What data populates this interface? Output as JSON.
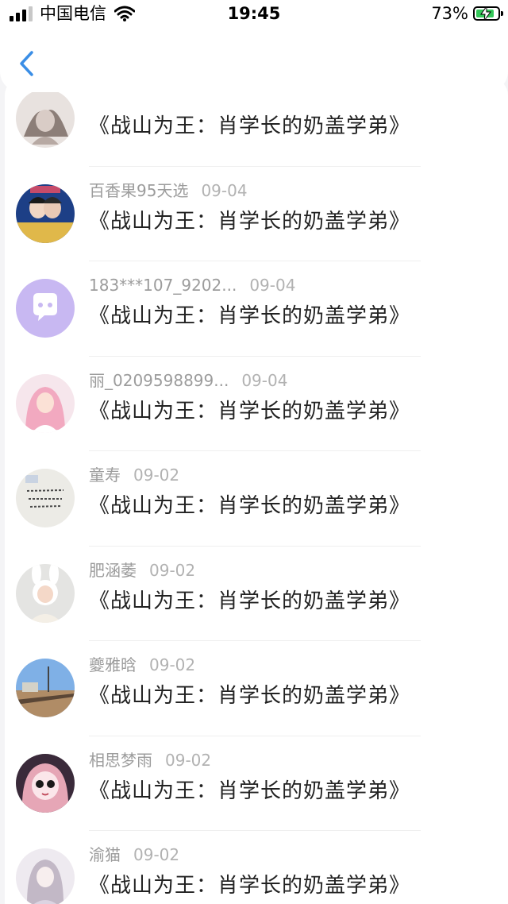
{
  "status_bar": {
    "carrier": "中国电信",
    "time": "19:45",
    "battery": "73%",
    "battery_level": 0.73
  },
  "header": {
    "back_icon": "chevron-left-icon",
    "accent": "#3a8ee6"
  },
  "comments": [
    {
      "user": "",
      "date": "",
      "title": "《战山为王：肖学长的奶盖学弟》"
    },
    {
      "user": "百香果95天选",
      "date": "09-04",
      "title": "《战山为王：肖学长的奶盖学弟》"
    },
    {
      "user": "183***107_9202...",
      "date": "09-04",
      "title": "《战山为王：肖学长的奶盖学弟》"
    },
    {
      "user": "丽_0209598899...",
      "date": "09-04",
      "title": "《战山为王：肖学长的奶盖学弟》"
    },
    {
      "user": "童寿",
      "date": "09-02",
      "title": "《战山为王：肖学长的奶盖学弟》"
    },
    {
      "user": "肥涵萎",
      "date": "09-02",
      "title": "《战山为王：肖学长的奶盖学弟》"
    },
    {
      "user": "夔雅晗",
      "date": "09-02",
      "title": "《战山为王：肖学长的奶盖学弟》"
    },
    {
      "user": "相思梦雨",
      "date": "09-02",
      "title": "《战山为王：肖学长的奶盖学弟》"
    },
    {
      "user": "渝猫",
      "date": "09-02",
      "title": "《战山为王：肖学长的奶盖学弟》"
    }
  ]
}
